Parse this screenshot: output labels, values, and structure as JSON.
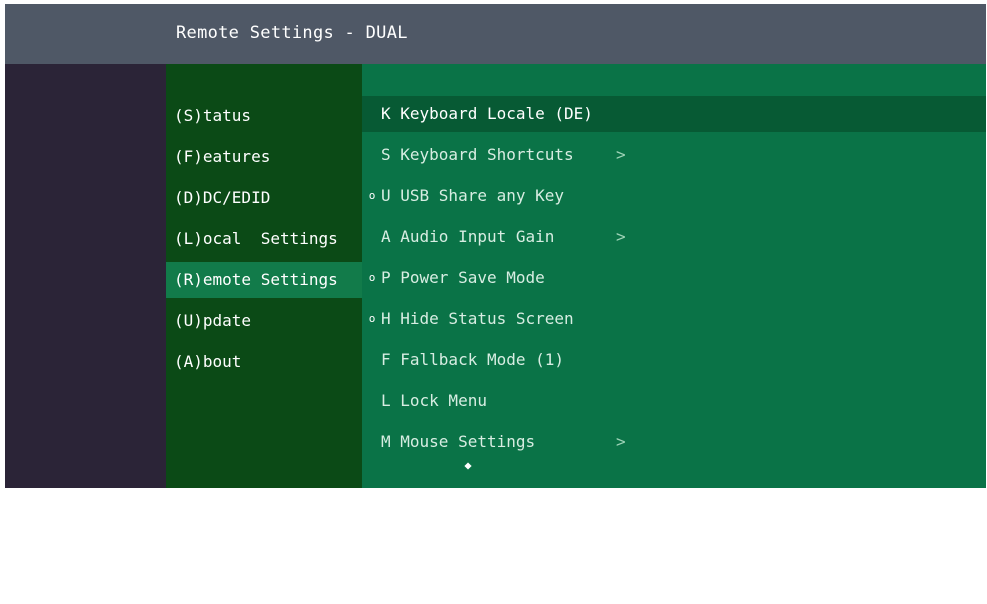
{
  "window": {
    "title": "Remote Settings - DUAL"
  },
  "nav": {
    "items": [
      {
        "label": "(S)tatus",
        "selected": false
      },
      {
        "label": "(F)eatures",
        "selected": false
      },
      {
        "label": "(D)DC/EDID",
        "selected": false
      },
      {
        "label": "(L)ocal  Settings",
        "selected": false
      },
      {
        "label": "(R)emote Settings",
        "selected": true
      },
      {
        "label": "(U)pdate",
        "selected": false
      },
      {
        "label": "(A)bout",
        "selected": false
      }
    ]
  },
  "menu": {
    "items": [
      {
        "bullet": "",
        "label": "K Keyboard Locale (DE)",
        "arrow": "",
        "selected": true
      },
      {
        "bullet": "",
        "label": "S Keyboard Shortcuts",
        "arrow": ">",
        "selected": false
      },
      {
        "bullet": "o",
        "label": "U USB Share any Key",
        "arrow": "",
        "selected": false
      },
      {
        "bullet": "",
        "label": "A Audio Input Gain",
        "arrow": ">",
        "selected": false
      },
      {
        "bullet": "o",
        "label": "P Power Save Mode",
        "arrow": "",
        "selected": false
      },
      {
        "bullet": "o",
        "label": "H Hide Status Screen",
        "arrow": "",
        "selected": false
      },
      {
        "bullet": "",
        "label": "F Fallback Mode (1)",
        "arrow": "",
        "selected": false
      },
      {
        "bullet": "",
        "label": "L Lock Menu",
        "arrow": "",
        "selected": false
      },
      {
        "bullet": "",
        "label": "M Mouse Settings",
        "arrow": ">",
        "selected": false
      }
    ],
    "more_indicator": "⯁"
  },
  "colors": {
    "titlebar": "#4f5866",
    "left_panel": "#2b2437",
    "nav_panel": "#0b4a16",
    "nav_selected": "#127b4a",
    "menu_panel": "#0a7347",
    "menu_selected": "#075a34"
  },
  "icons": {
    "bullet": "circle-bullet-icon",
    "submenu_arrow": "chevron-right-icon",
    "more": "scroll-down-indicator-icon"
  }
}
